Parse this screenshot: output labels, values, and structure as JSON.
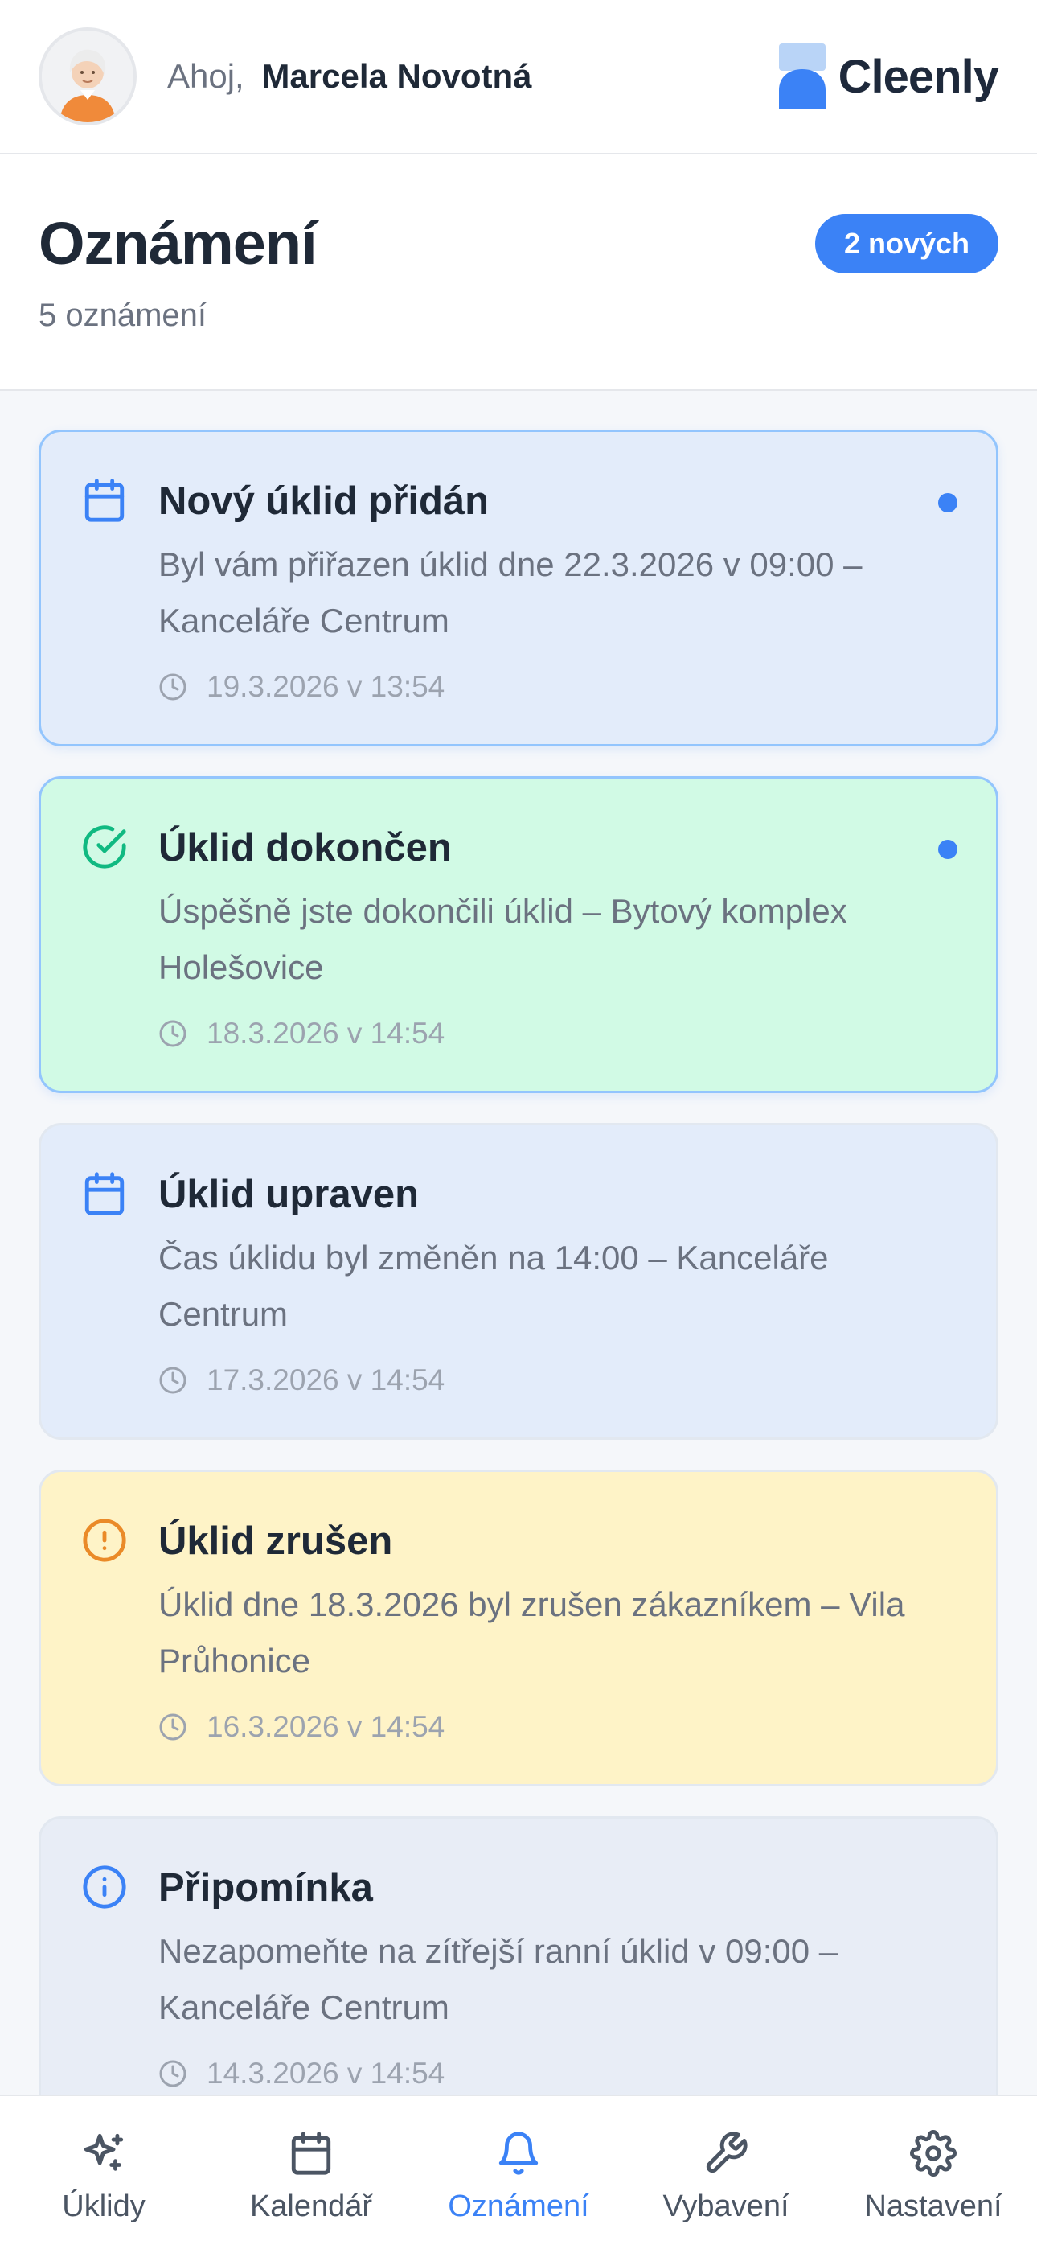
{
  "header": {
    "greeting": "Ahoj,",
    "user_name": "Marcela Novotná",
    "brand": "Cleenly"
  },
  "title_section": {
    "title": "Oznámení",
    "subtitle": "5 oznámení",
    "new_badge": "2 nových"
  },
  "notifications": [
    {
      "icon": "calendar-icon",
      "title": "Nový úklid přidán",
      "message": "Byl vám přiřazen úklid dne 22.3.2026 v 09:00 – Kanceláře Centrum",
      "time": "19.3.2026 v 13:54",
      "unread": true,
      "bg": "#e3ecfa"
    },
    {
      "icon": "check-circle-icon",
      "title": "Úklid dokončen",
      "message": "Úspěšně jste dokončili úklid – Bytový komplex Holešovice",
      "time": "18.3.2026 v 14:54",
      "unread": true,
      "bg": "#d1fae5"
    },
    {
      "icon": "calendar-icon",
      "title": "Úklid upraven",
      "message": "Čas úklidu byl změněn na 14:00 – Kanceláře Centrum",
      "time": "17.3.2026 v 14:54",
      "unread": false,
      "bg": "#e3ecfa"
    },
    {
      "icon": "alert-circle-icon",
      "title": "Úklid zrušen",
      "message": "Úklid dne 18.3.2026 byl zrušen zákazníkem – Vila Průhonice",
      "time": "16.3.2026 v 14:54",
      "unread": false,
      "bg": "#fef3c7"
    },
    {
      "icon": "info-icon",
      "title": "Připomínka",
      "message": "Nezapomeňte na zítřejší ranní úklid v 09:00 – Kanceláře Centrum",
      "time": "14.3.2026 v 14:54",
      "unread": false,
      "bg": "#e8edf6"
    }
  ],
  "bottom_nav": [
    {
      "label": "Úklidy",
      "icon": "sparkles-icon",
      "active": false
    },
    {
      "label": "Kalendář",
      "icon": "calendar-icon",
      "active": false
    },
    {
      "label": "Oznámení",
      "icon": "bell-icon",
      "active": true
    },
    {
      "label": "Vybavení",
      "icon": "wrench-icon",
      "active": false
    },
    {
      "label": "Nastavení",
      "icon": "gear-icon",
      "active": false
    }
  ],
  "colors": {
    "accent": "#3b82f6",
    "success": "#10b981",
    "warning": "#ea8a28",
    "unread_dot": "#3b82f6"
  }
}
